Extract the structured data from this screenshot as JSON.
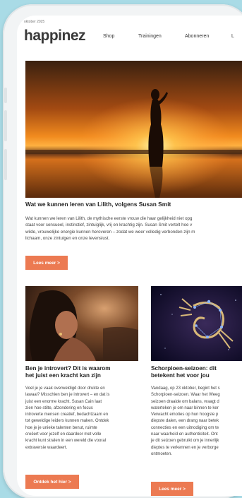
{
  "header": {
    "date": "oktober 2025",
    "logo": "happinez",
    "nav": [
      "Shop",
      "Trainingen",
      "Abonneren",
      "L"
    ]
  },
  "hero_article": {
    "title": "Wat we kunnen leren van Lilith, volgens Susan Smit",
    "body_lines": [
      "Wat kunnen we leren van Lilith, de mythische eerste vrouw die haar gelijkheid niet opg",
      "staat voor sensueel, instinctief, zintuiglijk, vrij en krachtig zijn. Susan Smit vertelt hoe v",
      "wilde, vrouwelijke energie kunnen heroveren – zodat we weer volledig verbonden zijn m",
      "lichaam, onze zintuigen en onze levenslust."
    ],
    "button": "Lees meer >"
  },
  "left_article": {
    "title_lines": [
      "Ben je introvert? Dit is waarom",
      "het juist een kracht kan zijn"
    ],
    "body_lines": [
      "Voel je je vaak overweldigd door drukte en",
      "lawaai? Misschien ben je introvert – en dat is",
      "juist een enorme kracht. Susan Cain laat",
      "zien hoe stilte, afzondering en focus",
      "introverte mensen creatief, bedachtzaam en",
      "tot geweldige leiders kunnen maken. Ontdek",
      "hoe je je unieke talenten benut, ruimte",
      "creëert voor jezelf en daardoor met volle",
      "kracht kunt stralen in een wereld die vooral",
      "extraversie waardeert."
    ],
    "button": "Ontdek het hier >"
  },
  "right_article": {
    "title_lines": [
      "Schorpioen-seizoen: dit",
      "betekent het voor jou"
    ],
    "body_lines": [
      "Vandaag, op 23 oktober, begint het s",
      "Schorpioen-seizoen. Waar het Weeg",
      "seizoen draaide om balans, vraagt d",
      "waterteken je om naar binnen te ker",
      "Verwacht emoties op hun hoogste p",
      "diepste dalen, een drang naar betek",
      "connecties en een uitnodiging om te",
      "naar waarheid en authenticiteit. Ont",
      "je dit seizoen gebruikt om je innerlijk",
      "dieptes te verkennen en je verborge",
      "ontmoeten."
    ],
    "button": "Lees meer >"
  },
  "colors": {
    "accent": "#ec7a52",
    "background": "#a9dbe6",
    "text": "#222222"
  }
}
